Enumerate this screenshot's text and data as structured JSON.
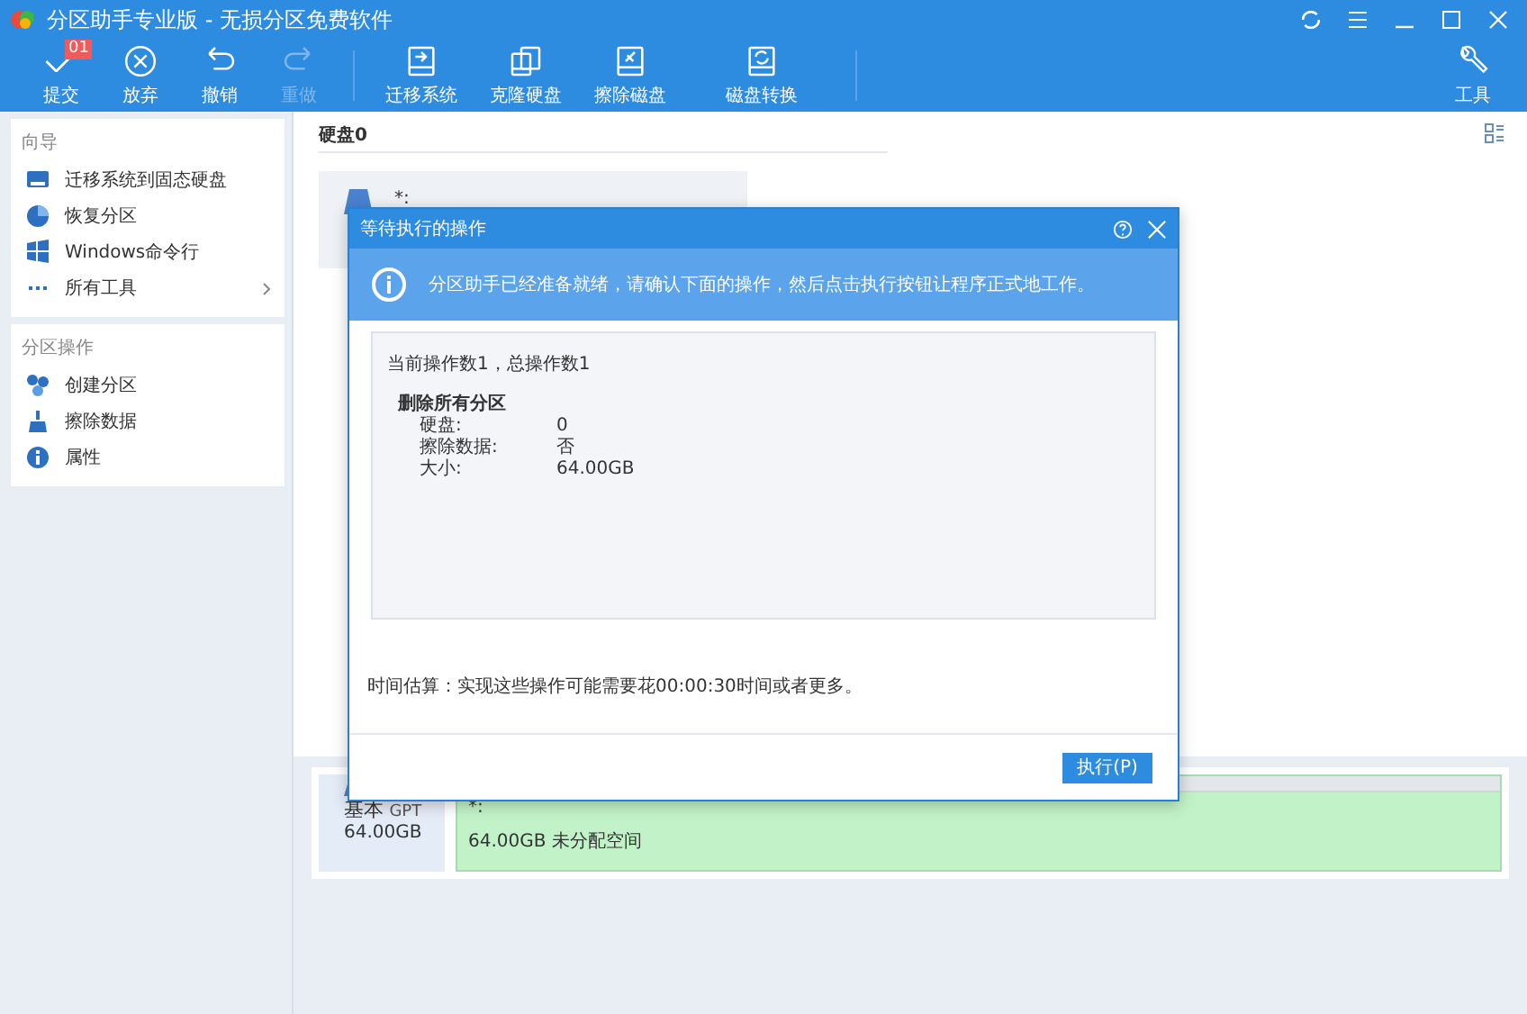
{
  "window": {
    "title": "分区助手专业版 - 无损分区免费软件"
  },
  "toolbar": {
    "items": [
      {
        "label": "提交",
        "disabled": false,
        "badge": "01"
      },
      {
        "label": "放弃",
        "disabled": false
      },
      {
        "label": "撤销",
        "disabled": false
      },
      {
        "label": "重做",
        "disabled": true
      },
      {
        "label": "迁移系统",
        "disabled": false
      },
      {
        "label": "克隆硬盘",
        "disabled": false
      },
      {
        "label": "擦除磁盘",
        "disabled": false
      },
      {
        "label": "磁盘转换",
        "disabled": false
      }
    ],
    "tools": {
      "label": "工具"
    }
  },
  "sidebar": {
    "sections": [
      {
        "title": "向导",
        "items": [
          {
            "label": "迁移系统到固态硬盘",
            "expandable": false
          },
          {
            "label": "恢复分区",
            "expandable": false
          },
          {
            "label": "Windows命令行",
            "expandable": false
          },
          {
            "label": "所有工具",
            "expandable": true
          }
        ]
      },
      {
        "title": "分区操作",
        "items": [
          {
            "label": "创建分区",
            "expandable": false
          },
          {
            "label": "擦除数据",
            "expandable": false
          },
          {
            "label": "属性",
            "expandable": false
          }
        ]
      }
    ]
  },
  "content": {
    "disk_header": "硬盘0",
    "top_partition": "*:",
    "disk_card": {
      "type": "基本",
      "style": "GPT",
      "capacity": "64.00GB",
      "partition": {
        "name": "*:",
        "description": "64.00GB 未分配空间"
      }
    }
  },
  "dialog": {
    "title": "等待执行的操作",
    "info": "分区助手已经准备就绪，请确认下面的操作，然后点击执行按钮让程序正式地工作。",
    "summary": "当前操作数1，总操作数1",
    "operation": "删除所有分区",
    "details": [
      {
        "label": "硬盘:",
        "value": "0"
      },
      {
        "label": "擦除数据:",
        "value": "否"
      },
      {
        "label": "大小:",
        "value": "64.00GB"
      }
    ],
    "estimate": "时间估算：实现这些操作可能需要花00:00:30时间或者更多。",
    "button": "执行(P)"
  }
}
